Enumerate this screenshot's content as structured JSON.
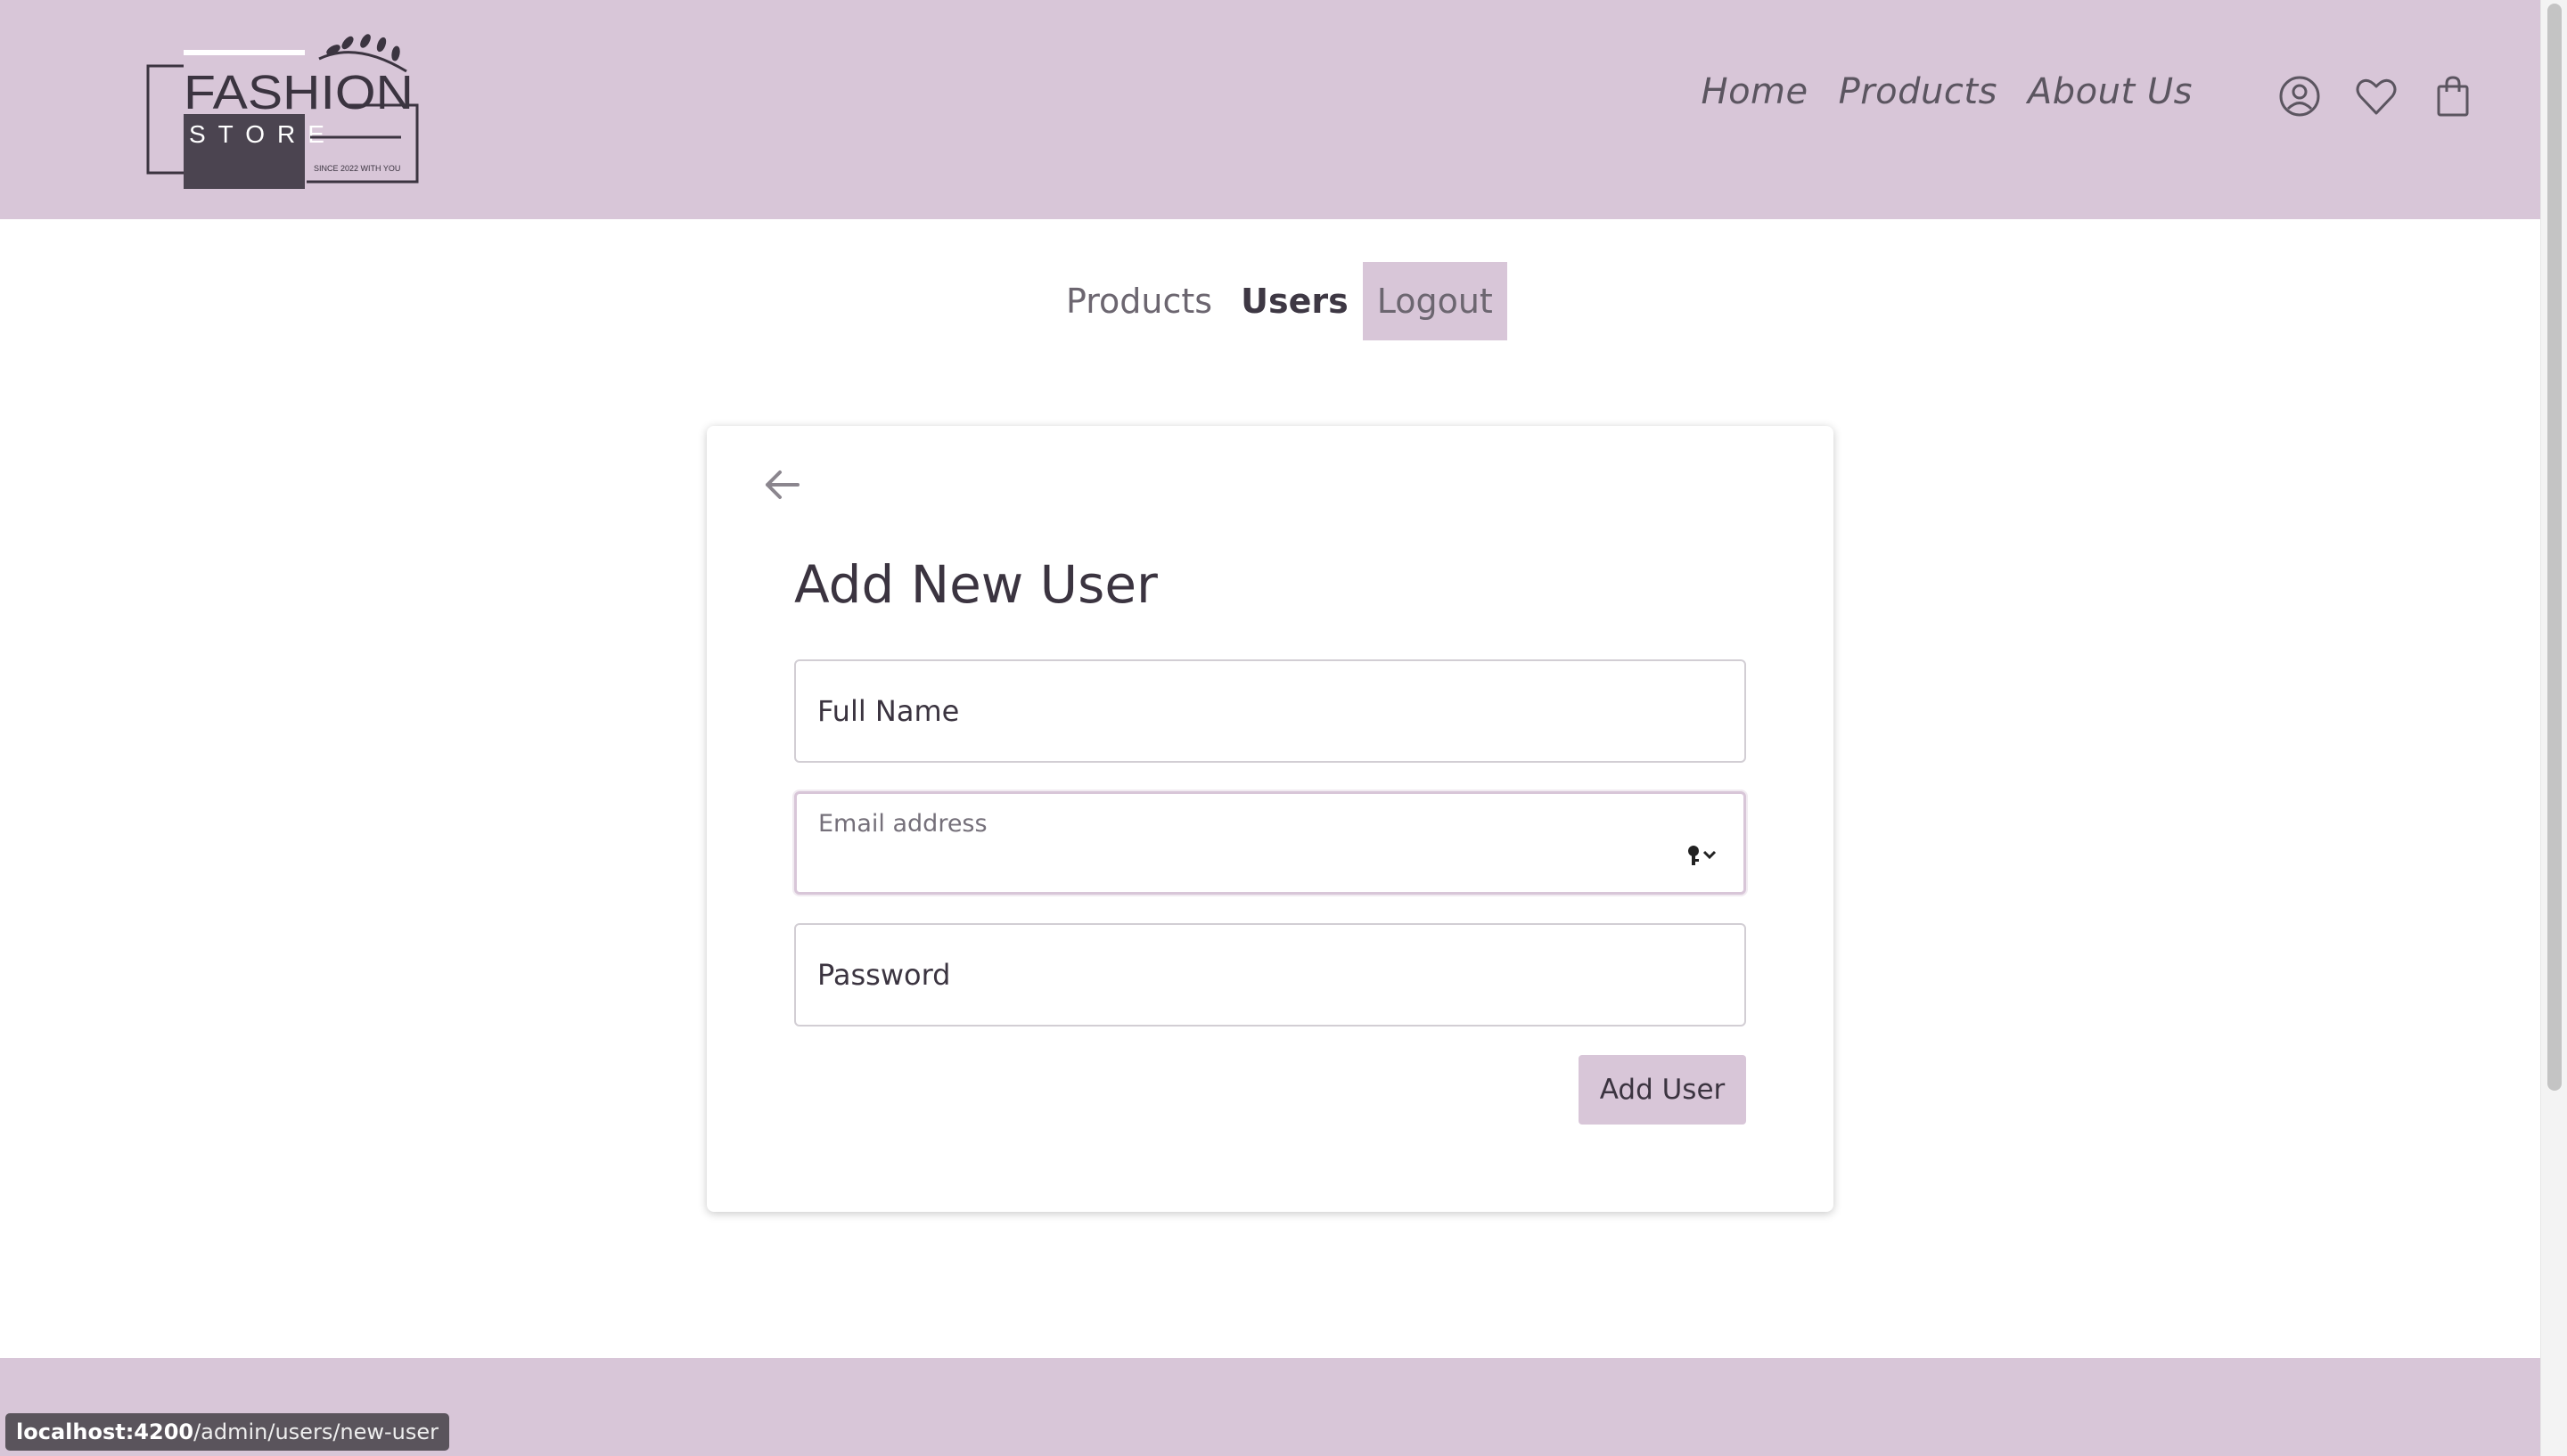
{
  "brand": {
    "name_line1": "FASHION",
    "name_line2": "STORE",
    "tagline": "SINCE 2022 WITH YOU"
  },
  "header": {
    "nav": [
      "Home",
      "Products",
      "About Us"
    ],
    "icons": [
      "user-icon",
      "heart-icon",
      "shopping-bag-icon"
    ]
  },
  "admin_nav": {
    "products": "Products",
    "users": "Users",
    "logout": "Logout",
    "active": "Users"
  },
  "form": {
    "title": "Add New User",
    "full_name_placeholder": "Full Name",
    "email_label": "Email address",
    "email_value": "",
    "password_placeholder": "Password",
    "submit": "Add User",
    "back_icon": "arrow-left-icon",
    "autofill_icon": "key-icon"
  },
  "status": {
    "host": "localhost:4200",
    "path": "/admin/users/new-user"
  },
  "colors": {
    "brand_lilac": "#d8c6d8",
    "text_dark": "#3b3440"
  }
}
